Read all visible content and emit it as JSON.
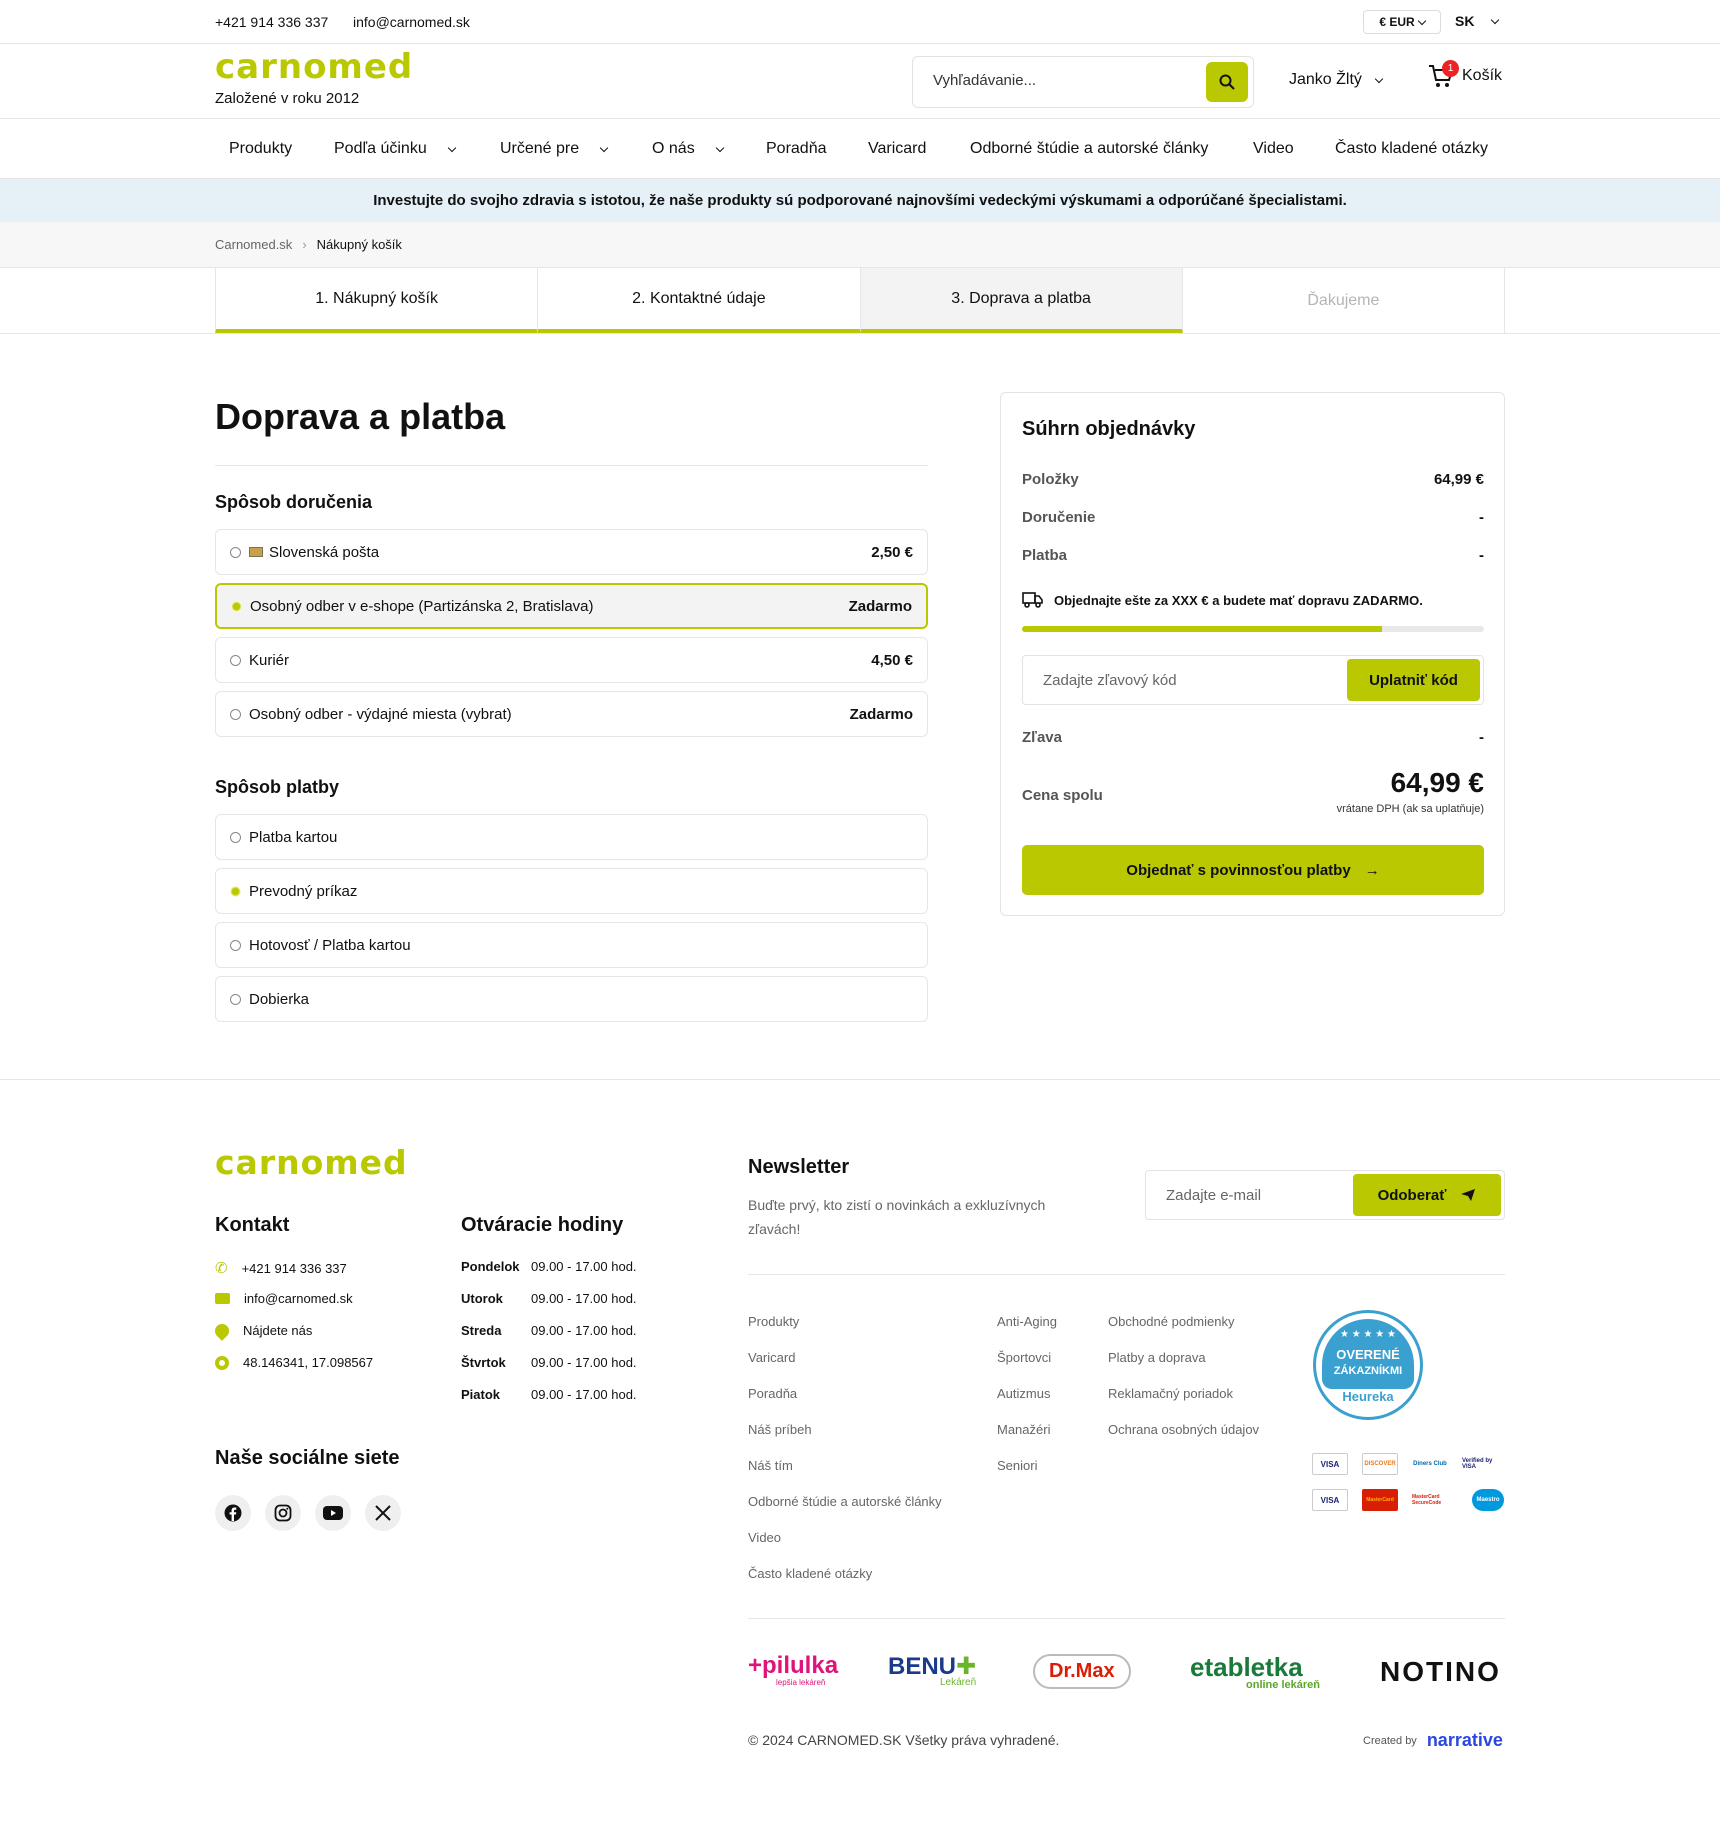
{
  "topbar": {
    "phone": "+421 914 336 337",
    "email": "info@carnomed.sk",
    "currency": "€ EUR",
    "language": "SK"
  },
  "header": {
    "tagline": "Založené v roku 2012",
    "search_placeholder": "Vyhľadávanie...",
    "user": "Janko Žltý",
    "cart_label": "Košík",
    "cart_count": "1"
  },
  "nav": [
    "Produkty",
    "Podľa účinku",
    "Určené pre",
    "O nás",
    "Poradňa",
    "Varicard",
    "Odborné štúdie a autorské články",
    "Video",
    "Často kladené otázky"
  ],
  "banner": "Investujte do svojho zdravia s istotou, že naše produkty sú podporované najnovšími vedeckými výskumami a odporúčané špecialistami.",
  "breadcrumb": [
    "Carnomed.sk",
    "Nákupný košík"
  ],
  "steps": [
    "1. Nákupný košík",
    "2. Kontaktné údaje",
    "3. Doprava a platba",
    "Ďakujeme"
  ],
  "page_title": "Doprava a platba",
  "delivery": {
    "title": "Spôsob doručenia",
    "options": [
      {
        "label": "Slovenská pošta",
        "price": "2,50 €"
      },
      {
        "label": "Osobný odber v e-shope (Partizánska 2, Bratislava)",
        "price": "Zadarmo"
      },
      {
        "label": "Kuriér",
        "price": "4,50 €"
      },
      {
        "label": "Osobný odber - výdajné miesta (vybrat)",
        "price": "Zadarmo"
      }
    ]
  },
  "payment": {
    "title": "Spôsob platby",
    "options": [
      "Platba kartou",
      "Prevodný príkaz",
      "Hotovosť / Platba kartou",
      "Dobierka"
    ]
  },
  "summary": {
    "title": "Súhrn objednávky",
    "items_label": "Položky",
    "items_value": "64,99 €",
    "delivery_label": "Doručenie",
    "delivery_value": "-",
    "payment_label": "Platba",
    "payment_value": "-",
    "shipping_note": "Objednajte ešte za XXX € a budete mať dopravu ZADARMO.",
    "shipping_progress": 0.78,
    "coupon_placeholder": "Zadajte zľavový kód",
    "coupon_button": "Uplatniť kód",
    "discount_label": "Zľava",
    "discount_value": "-",
    "total_label": "Cena spolu",
    "total_value": "64,99 €",
    "vat_note": "vrátane DPH (ak sa uplatňuje)",
    "order_button": "Objednať s povinnosťou platby"
  },
  "footer": {
    "contact_title": "Kontakt",
    "contact": [
      "+421 914 336 337",
      "info@carnomed.sk",
      "Nájdete nás",
      "48.146341, 17.098567"
    ],
    "hours_title": "Otváracie hodiny",
    "hours": [
      {
        "day": "Pondelok",
        "time": "09.00 - 17.00 hod."
      },
      {
        "day": "Utorok",
        "time": "09.00 - 17.00 hod."
      },
      {
        "day": "Streda",
        "time": "09.00 - 17.00 hod."
      },
      {
        "day": "Štvrtok",
        "time": "09.00 - 17.00 hod."
      },
      {
        "day": "Piatok",
        "time": "09.00 - 17.00 hod."
      }
    ],
    "social_title": "Naše sociálne siete",
    "newsletter_title": "Newsletter",
    "newsletter_text": "Buďte prvý, kto zistí o novinkách a exkluzívnych zľavách!",
    "newsletter_placeholder": "Zadajte e-mail",
    "newsletter_button": "Odoberať",
    "links_col1": [
      "Produkty",
      "Varicard",
      "Poradňa",
      "Náš príbeh",
      "Náš tím",
      "Odborné štúdie a autorské články",
      "Video",
      "Často kladené otázky"
    ],
    "links_col2": [
      "Anti-Aging",
      "Športovci",
      "Autizmus",
      "Manažéri",
      "Seniori"
    ],
    "links_col3": [
      "Obchodné podmienky",
      "Platby a doprava",
      "Reklamačný poriadok",
      "Ochrana osobných údajov"
    ],
    "heureka_line1": "OVERENÉ",
    "heureka_line2": "ZÁKAZNÍKMI",
    "heureka_brand": "Heureka",
    "cards": [
      "VISA",
      "DISCOVER",
      "Diners Club",
      "Verified by VISA",
      "VISA",
      "MasterCard",
      "MasterCard SecureCode",
      "Maestro"
    ],
    "partners": [
      "+pilulka",
      "BENU",
      "Dr.Max",
      "etabletka",
      "NOTINO"
    ],
    "partner_subs": [
      "lepšia lekáreň",
      "Lekáreň",
      "online lekáreň"
    ],
    "copyright": "© 2024 CARNOMED.SK Všetky práva vyhradené.",
    "created_by": "Created by",
    "agency": "narrative"
  },
  "colors": {
    "accent": "#b9c800",
    "banner": "#e6f1f7",
    "badge": "#ee2222"
  }
}
